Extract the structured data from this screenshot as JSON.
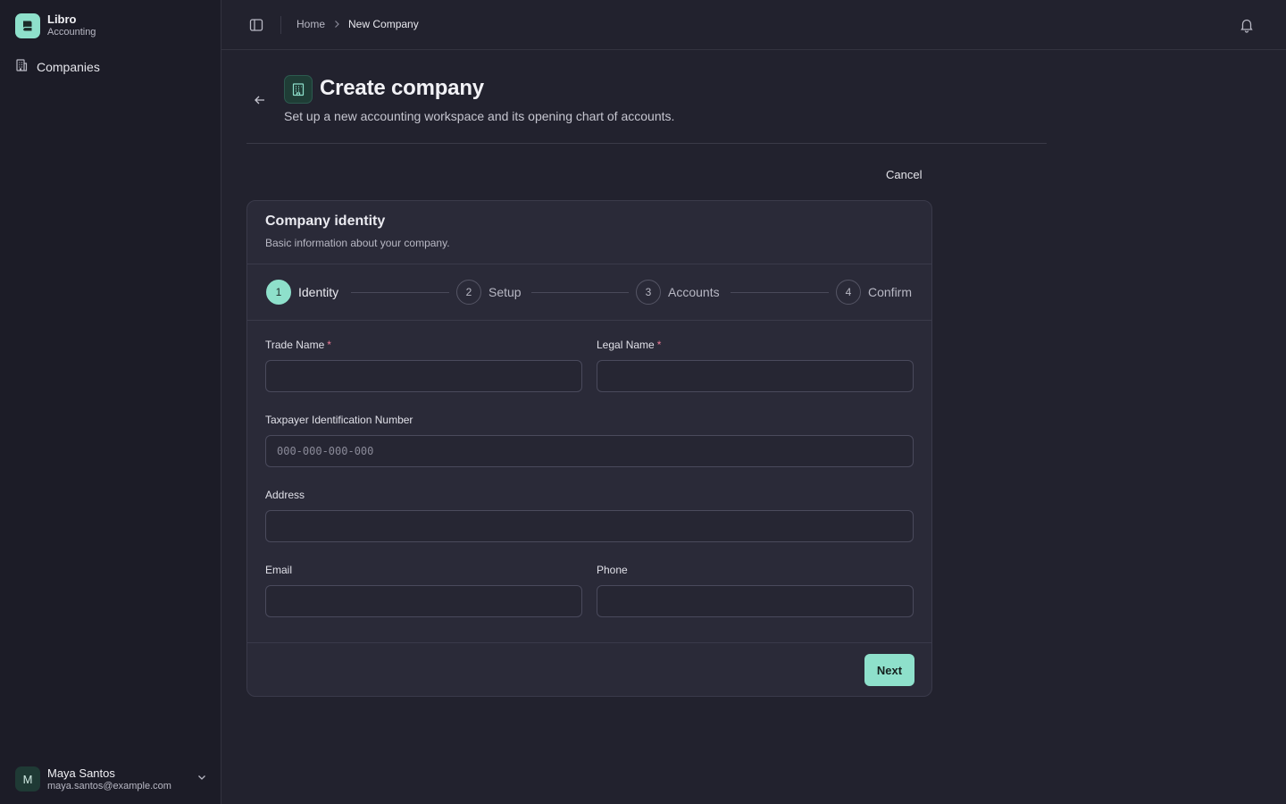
{
  "brand": {
    "name": "Libro",
    "subtitle": "Accounting"
  },
  "sidebar": {
    "items": [
      {
        "label": "Companies",
        "icon": "building-icon"
      }
    ]
  },
  "user": {
    "name": "Maya Santos",
    "email": "maya.santos@example.com",
    "initial": "M"
  },
  "header": {
    "breadcrumb": {
      "home": "Home",
      "current": "New Company"
    }
  },
  "page": {
    "title": "Create company",
    "subtitle": "Set up a new accounting workspace and its opening chart of accounts.",
    "cancel_label": "Cancel"
  },
  "card": {
    "title": "Company identity",
    "description": "Basic information about your company."
  },
  "steps": [
    {
      "number": "1",
      "label": "Identity",
      "active": true
    },
    {
      "number": "2",
      "label": "Setup",
      "active": false
    },
    {
      "number": "3",
      "label": "Accounts",
      "active": false
    },
    {
      "number": "4",
      "label": "Confirm",
      "active": false
    }
  ],
  "form": {
    "trade_name": {
      "label": "Trade Name",
      "required": "*",
      "value": ""
    },
    "legal_name": {
      "label": "Legal Name",
      "required": "*",
      "value": ""
    },
    "tin": {
      "label": "Taxpayer Identification Number",
      "placeholder": "000-000-000-000",
      "value": ""
    },
    "address": {
      "label": "Address",
      "value": ""
    },
    "email": {
      "label": "Email",
      "value": ""
    },
    "phone": {
      "label": "Phone",
      "value": ""
    }
  },
  "actions": {
    "next_label": "Next"
  },
  "colors": {
    "accent": "#8ee0cb",
    "required": "#ef7a96",
    "background": "#22222e",
    "sidebar": "#1c1c27"
  }
}
